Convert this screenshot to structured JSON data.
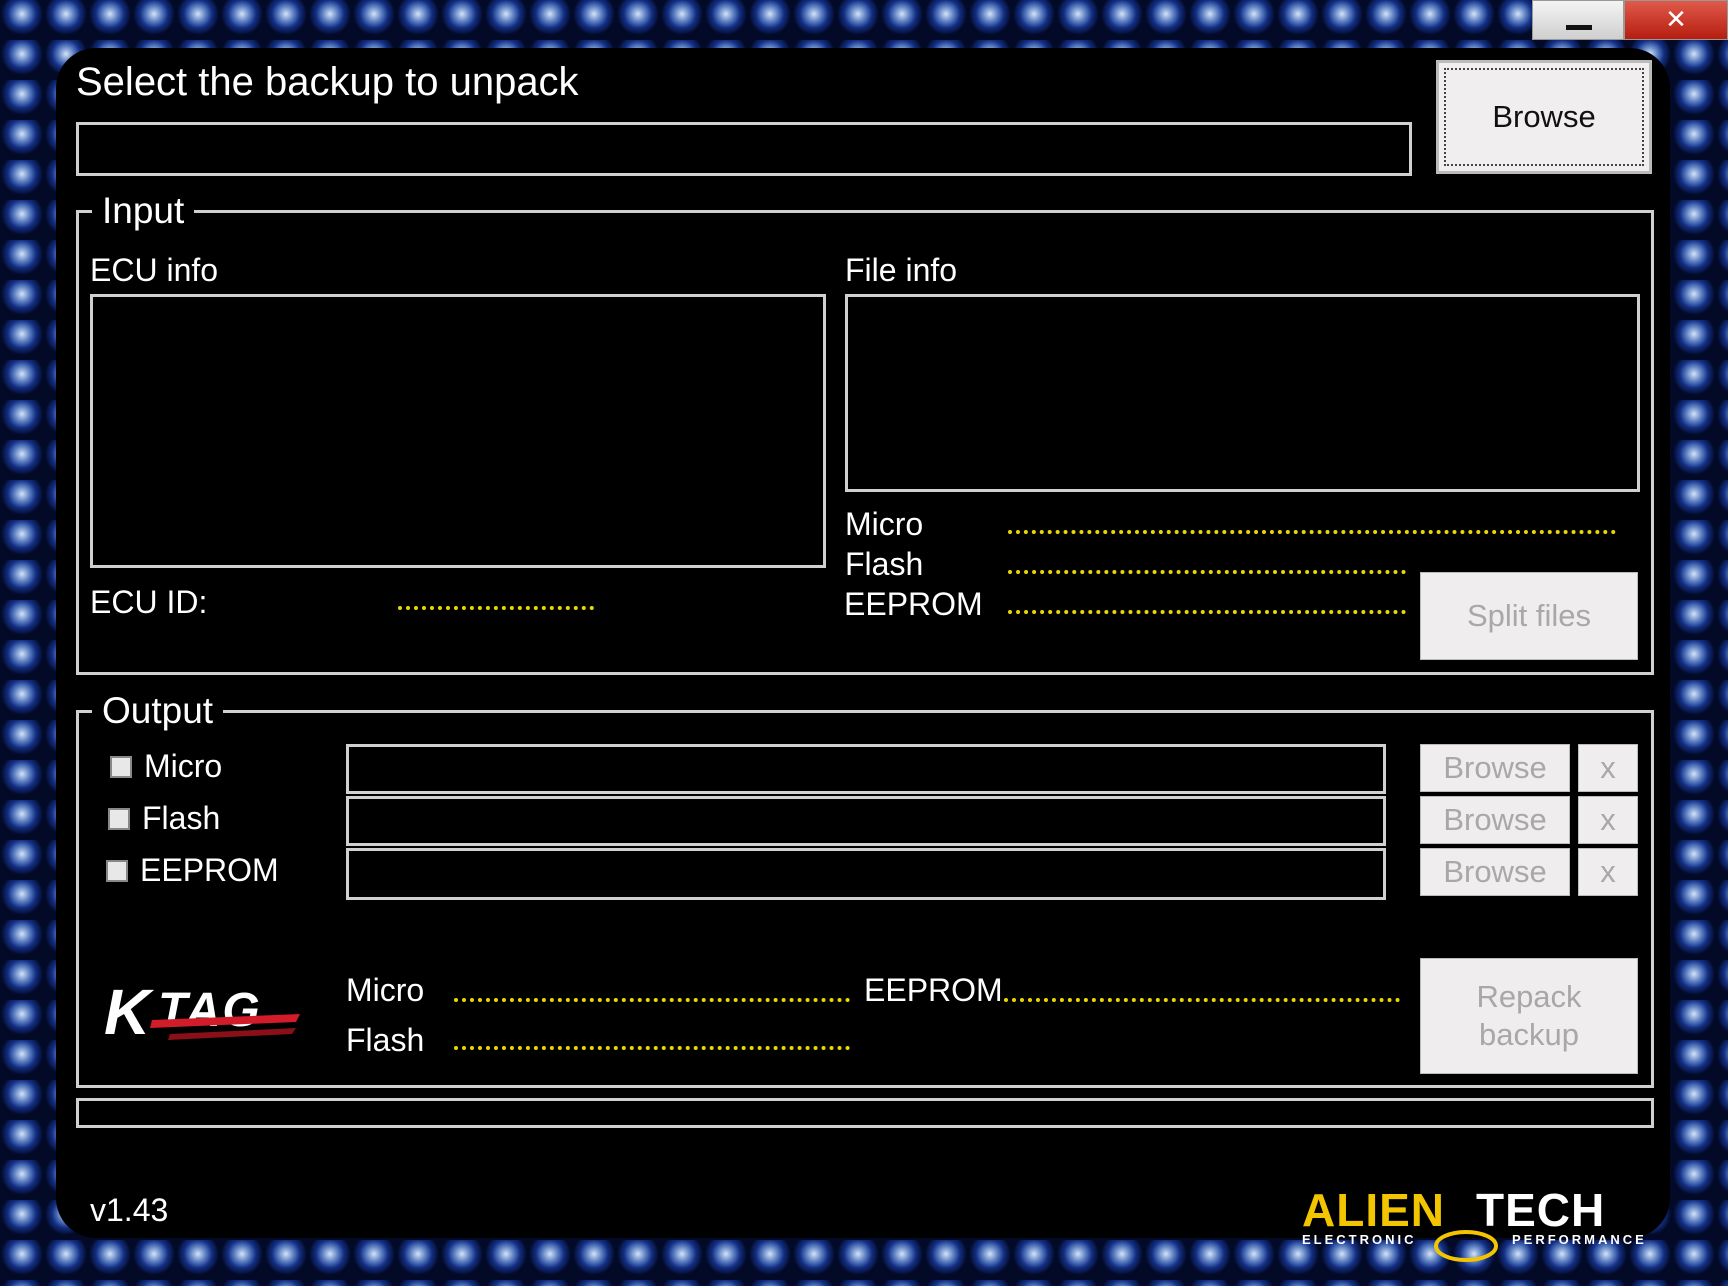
{
  "window_controls": {
    "minimize_icon": "minimize-icon",
    "close_label": "✕"
  },
  "header": {
    "title": "Select the backup to unpack",
    "path_value": "",
    "browse_label": "Browse"
  },
  "input": {
    "legend": "Input",
    "ecu_info_label": "ECU info",
    "file_info_label": "File info",
    "ecu_id_label": "ECU ID:",
    "ecu_id_value": "",
    "micro_label": "Micro",
    "flash_label": "Flash",
    "eeprom_label": "EEPROM",
    "split_label": "Split files"
  },
  "output": {
    "legend": "Output",
    "rows": [
      {
        "label": "Micro",
        "browse": "Browse",
        "clear": "x"
      },
      {
        "label": "Flash",
        "browse": "Browse",
        "clear": "x"
      },
      {
        "label": "EEPROM",
        "browse": "Browse",
        "clear": "x"
      }
    ],
    "summary": {
      "micro_label": "Micro",
      "flash_label": "Flash",
      "eeprom_label": "EEPROM"
    },
    "repack_label_line1": "Repack",
    "repack_label_line2": "backup"
  },
  "branding": {
    "ktag_logo": "KTAG",
    "alientech_logo": "ALIENTECH",
    "alientech_sub_left": "ELECTRONIC",
    "alientech_sub_right": "PERFORMANCE"
  },
  "footer": {
    "version": "v1.43",
    "progress": 0
  },
  "colors": {
    "dots": "#e8d800",
    "ktag_red": "#d31c2a",
    "alientech_yellow": "#f2c500"
  }
}
